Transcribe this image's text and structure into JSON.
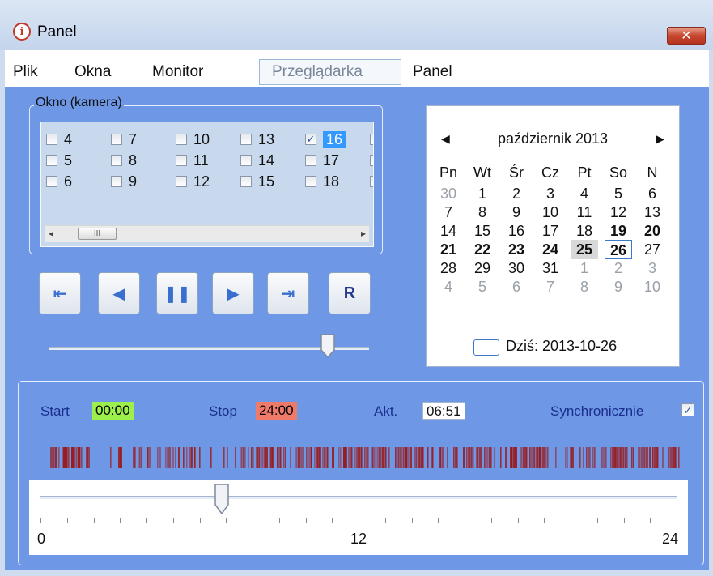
{
  "window": {
    "title": "Panel",
    "close_glyph": "✕"
  },
  "menu": [
    "Plik",
    "Okna",
    "Monitor",
    "Przeglądarka",
    "Panel"
  ],
  "menu_active_index": 3,
  "camera_group": {
    "label": "Okno (kamera)",
    "items": [
      {
        "label": "4",
        "checked": false
      },
      {
        "label": "5",
        "checked": false
      },
      {
        "label": "6",
        "checked": false
      },
      {
        "label": "7",
        "checked": false
      },
      {
        "label": "8",
        "checked": false
      },
      {
        "label": "9",
        "checked": false
      },
      {
        "label": "10",
        "checked": false
      },
      {
        "label": "11",
        "checked": false
      },
      {
        "label": "12",
        "checked": false
      },
      {
        "label": "13",
        "checked": false
      },
      {
        "label": "14",
        "checked": false
      },
      {
        "label": "15",
        "checked": false
      },
      {
        "label": "16",
        "checked": true,
        "selected": true
      },
      {
        "label": "17",
        "checked": false
      },
      {
        "label": "18",
        "checked": false
      }
    ],
    "scroll_thumb_glyph": "III"
  },
  "playback": {
    "buttons": [
      {
        "name": "first-frame-button",
        "icon": "skip-to-start-icon",
        "glyph": "⇤"
      },
      {
        "name": "step-back-button",
        "icon": "play-reverse-icon",
        "glyph": "◀"
      },
      {
        "name": "pause-button",
        "icon": "pause-icon",
        "glyph": "❚❚"
      },
      {
        "name": "play-button",
        "icon": "play-icon",
        "glyph": "▶"
      },
      {
        "name": "last-frame-button",
        "icon": "skip-to-end-icon",
        "glyph": "⇥"
      },
      {
        "name": "reset-button",
        "icon": "reset-icon",
        "glyph": "R"
      }
    ],
    "speed_position": 0.87
  },
  "calendar": {
    "month_title": "październik 2013",
    "prev": "◀",
    "next": "▶",
    "weekdays": [
      "Pn",
      "Wt",
      "Śr",
      "Cz",
      "Pt",
      "So",
      "N"
    ],
    "weeks": [
      [
        {
          "d": "30",
          "o": true
        },
        {
          "d": "1"
        },
        {
          "d": "2"
        },
        {
          "d": "3"
        },
        {
          "d": "4"
        },
        {
          "d": "5"
        },
        {
          "d": "6"
        }
      ],
      [
        {
          "d": "7"
        },
        {
          "d": "8"
        },
        {
          "d": "9"
        },
        {
          "d": "10"
        },
        {
          "d": "11"
        },
        {
          "d": "12"
        },
        {
          "d": "13"
        }
      ],
      [
        {
          "d": "14"
        },
        {
          "d": "15"
        },
        {
          "d": "16"
        },
        {
          "d": "17"
        },
        {
          "d": "18"
        },
        {
          "d": "19",
          "b": true
        },
        {
          "d": "20",
          "b": true
        }
      ],
      [
        {
          "d": "21",
          "b": true
        },
        {
          "d": "22",
          "b": true
        },
        {
          "d": "23",
          "b": true
        },
        {
          "d": "24",
          "b": true
        },
        {
          "d": "25",
          "b": true,
          "hot": true
        },
        {
          "d": "26",
          "b": true,
          "today": true
        },
        {
          "d": "27"
        }
      ],
      [
        {
          "d": "28"
        },
        {
          "d": "29"
        },
        {
          "d": "30"
        },
        {
          "d": "31"
        },
        {
          "d": "1",
          "o": true
        },
        {
          "d": "2",
          "o": true
        },
        {
          "d": "3",
          "o": true
        }
      ],
      [
        {
          "d": "4",
          "o": true
        },
        {
          "d": "5",
          "o": true
        },
        {
          "d": "6",
          "o": true
        },
        {
          "d": "7",
          "o": true
        },
        {
          "d": "8",
          "o": true
        },
        {
          "d": "9",
          "o": true
        },
        {
          "d": "10",
          "o": true
        }
      ]
    ],
    "today_label": "Dziś: 2013-10-26"
  },
  "time": {
    "start_label": "Start",
    "start_value": "00:00",
    "start_color": "#9cf04a",
    "stop_label": "Stop",
    "stop_value": "24:00",
    "stop_color": "#f07a6a",
    "akt_label": "Akt.",
    "akt_value": "06:51",
    "sync_label": "Synchronicznie",
    "sync_checked": true
  },
  "timeline": {
    "bar_color": "#9b1a1a",
    "position_hours": 6.85,
    "range": [
      0,
      24
    ],
    "tick_labels": [
      "0",
      "12",
      "24"
    ]
  }
}
